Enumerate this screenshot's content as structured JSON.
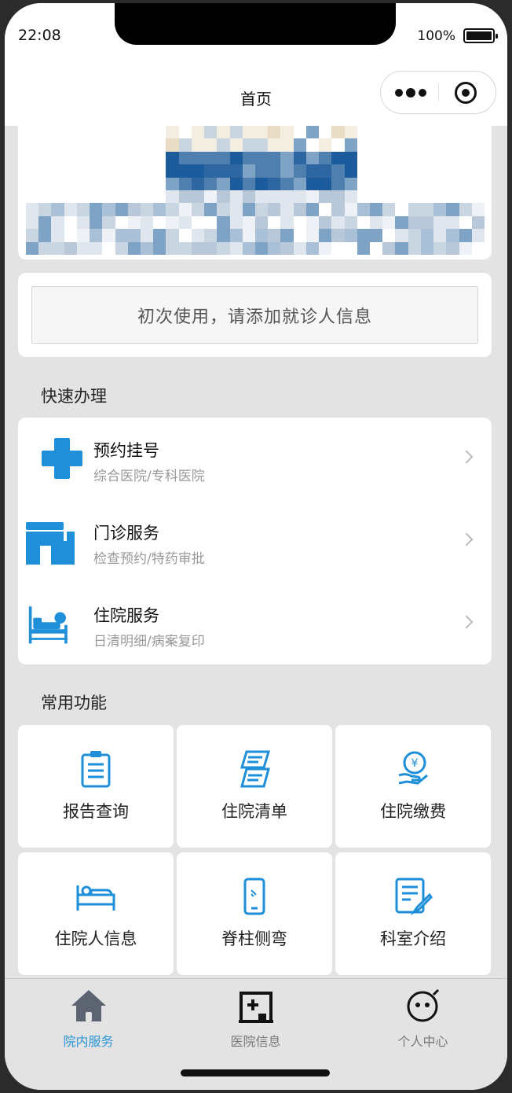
{
  "status_bar": {
    "time": "22:08",
    "battery": "100%"
  },
  "navbar": {
    "title": "首页"
  },
  "add_patient": {
    "label": "初次使用，请添加就诊人信息"
  },
  "quick": {
    "title": "快速办理",
    "items": [
      {
        "title": "预约挂号",
        "sub": "综合医院/专科医院",
        "icon": "medical-cross-icon"
      },
      {
        "title": "门诊服务",
        "sub": "检查预约/特药审批",
        "icon": "clinic-building-icon"
      },
      {
        "title": "住院服务",
        "sub": "日清明细/病案复印",
        "icon": "hospital-bed-icon"
      }
    ]
  },
  "common": {
    "title": "常用功能",
    "items": [
      {
        "label": "报告查询",
        "icon": "clipboard-icon"
      },
      {
        "label": "住院清单",
        "icon": "bill-list-icon"
      },
      {
        "label": "住院缴费",
        "icon": "payment-yen-icon"
      },
      {
        "label": "住院人信息",
        "icon": "patient-bed-icon"
      },
      {
        "label": "脊柱侧弯",
        "icon": "phone-scan-icon"
      },
      {
        "label": "科室介绍",
        "icon": "document-edit-icon"
      }
    ]
  },
  "tabs": [
    {
      "label": "院内服务",
      "icon": "home-icon",
      "active": true
    },
    {
      "label": "医院信息",
      "icon": "hospital-icon",
      "active": false
    },
    {
      "label": "个人中心",
      "icon": "smiley-icon",
      "active": false
    }
  ],
  "colors": {
    "accent": "#2a96d6",
    "icon_blue": "#1e8fd8"
  }
}
